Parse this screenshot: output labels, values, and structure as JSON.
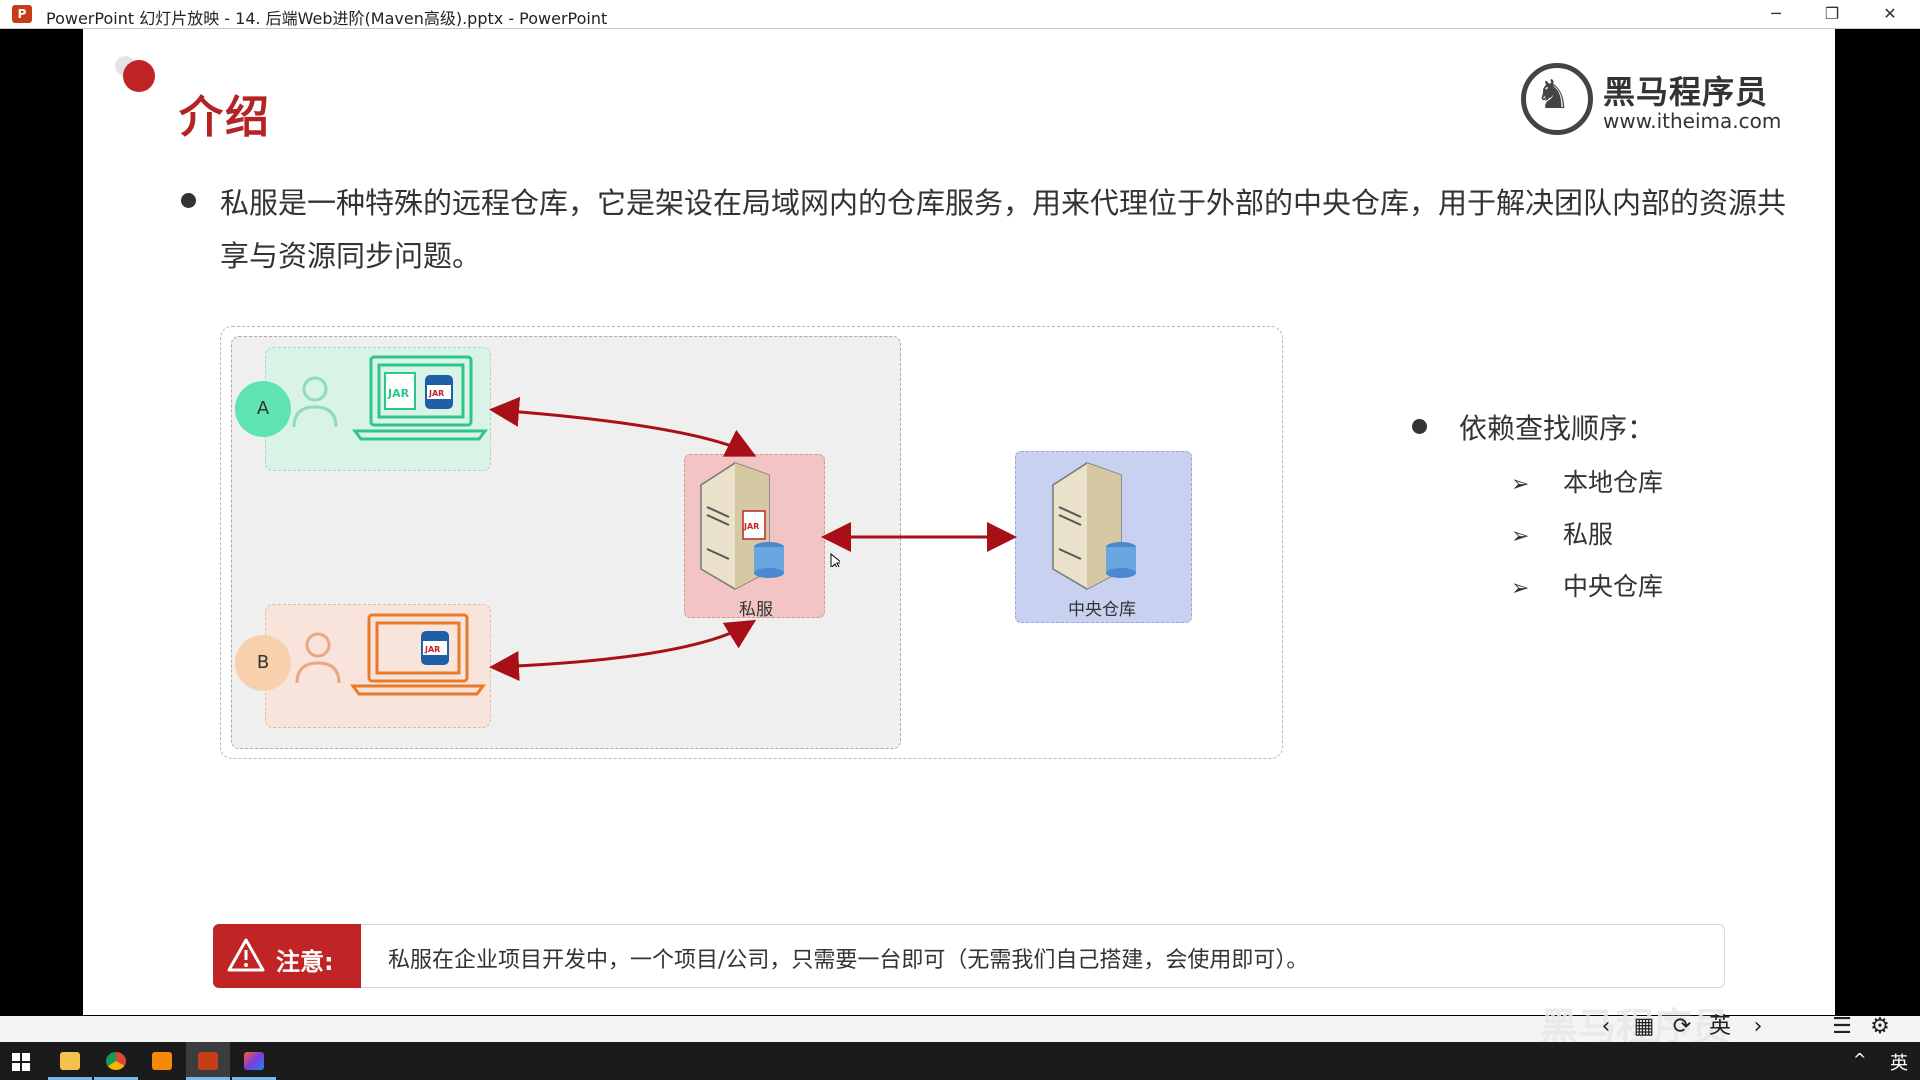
{
  "window": {
    "title": "PowerPoint 幻灯片放映  -  14. 后端Web进阶(Maven高级).pptx - PowerPoint",
    "app_icon": "P",
    "minimize": "─",
    "restore": "❐",
    "close": "✕"
  },
  "slide": {
    "title": "介绍",
    "logo": {
      "name_cn": "黑马程序员",
      "url": "www.itheima.com"
    },
    "intro": "私服是一种特殊的远程仓库，它是架设在局域网内的仓库服务，用来代理位于外部的中央仓库，用于解决团队内部的资源共享与资源同步问题。",
    "diagram": {
      "client_a": "A",
      "client_b": "B",
      "jar_badge": "JAR",
      "private_server": "私服",
      "central_repo": "中央仓库"
    },
    "lookup": {
      "title": "依赖查找顺序：",
      "items": [
        "本地仓库",
        "私服",
        "中央仓库"
      ]
    },
    "note": {
      "label": "注意:",
      "text": "私服在企业项目开发中，一个项目/公司，只需要一台即可（无需我们自己搭建，会使用即可）。"
    }
  },
  "overlay_watermark": "黑马程序员",
  "slideshow_controls": [
    "‹",
    "▦",
    "⟳",
    "英",
    "›",
    "☰",
    "⚙"
  ],
  "taskbar": {
    "apps": [
      "start",
      "file-explorer",
      "chrome",
      "sublime-text",
      "powerpoint",
      "intellij-idea"
    ],
    "tray_caret": "^",
    "ime": "英"
  },
  "colors": {
    "accent_red": "#c02424",
    "client_a": "#5ee3b3",
    "client_b": "#f8d0ac",
    "private_box": "#f2c4c4",
    "central_box": "#c8d2f0",
    "arrow": "#a80f16"
  }
}
